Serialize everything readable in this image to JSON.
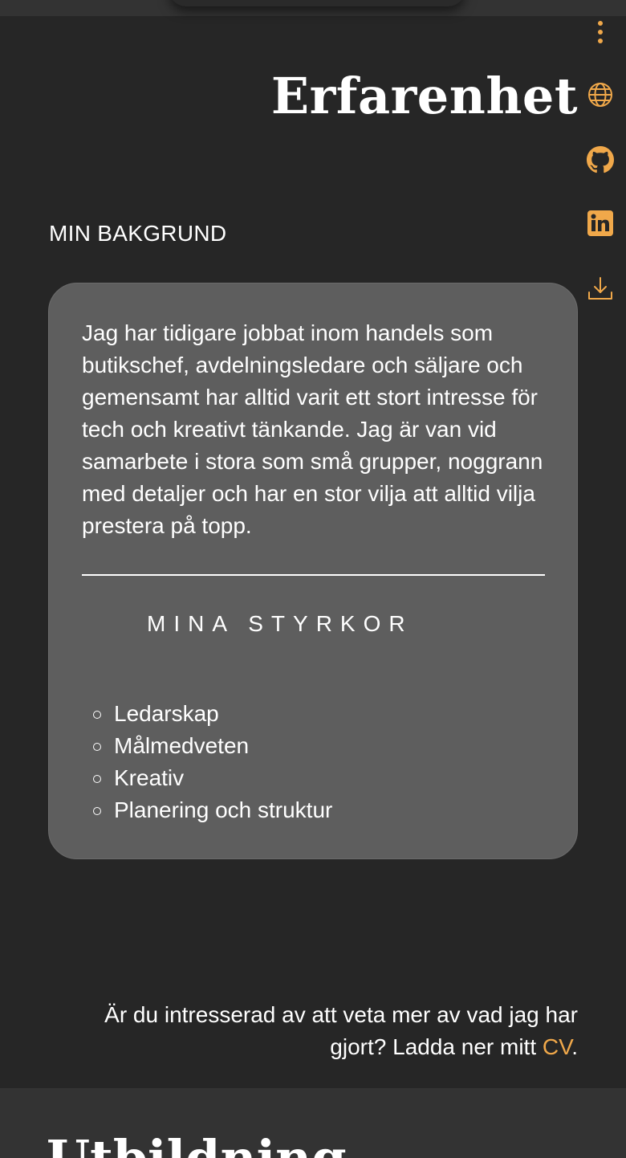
{
  "header": {
    "title": "Erfarenhet"
  },
  "side_nav": {
    "items": [
      {
        "icon": "more-vertical-icon",
        "label": "Meny"
      },
      {
        "icon": "globe-icon",
        "label": "Webbplats"
      },
      {
        "icon": "github-icon",
        "label": "GitHub"
      },
      {
        "icon": "linkedin-icon",
        "label": "LinkedIn"
      },
      {
        "icon": "download-icon",
        "label": "Ladda ner CV"
      }
    ],
    "accent_color": "#f0a84a"
  },
  "background_section": {
    "label": "MIN BAKGRUND",
    "intro": "Jag har tidigare jobbat inom handels som butikschef, avdelningsledare och säljare och gemensamt har alltid varit ett stort intresse för tech och kreativt tänkande. Jag är van vid samarbete i stora som små grupper, noggrann med detaljer och har en stor vilja att alltid vilja prestera på topp.",
    "strengths_title": "MINA STYRKOR",
    "strengths": [
      "Ledarskap",
      "Målmedveten",
      "Kreativ",
      "Planering och struktur"
    ]
  },
  "cta": {
    "text": "Är du intresserad av att veta mer av vad jag har gjort? Ladda ner mitt ",
    "link_label": "CV",
    "end": "."
  },
  "next_section": {
    "title": "Utbildning"
  },
  "colors": {
    "background": "#262626",
    "card": "#5e5e5e",
    "accent": "#f0a84a",
    "text": "#ffffff"
  }
}
